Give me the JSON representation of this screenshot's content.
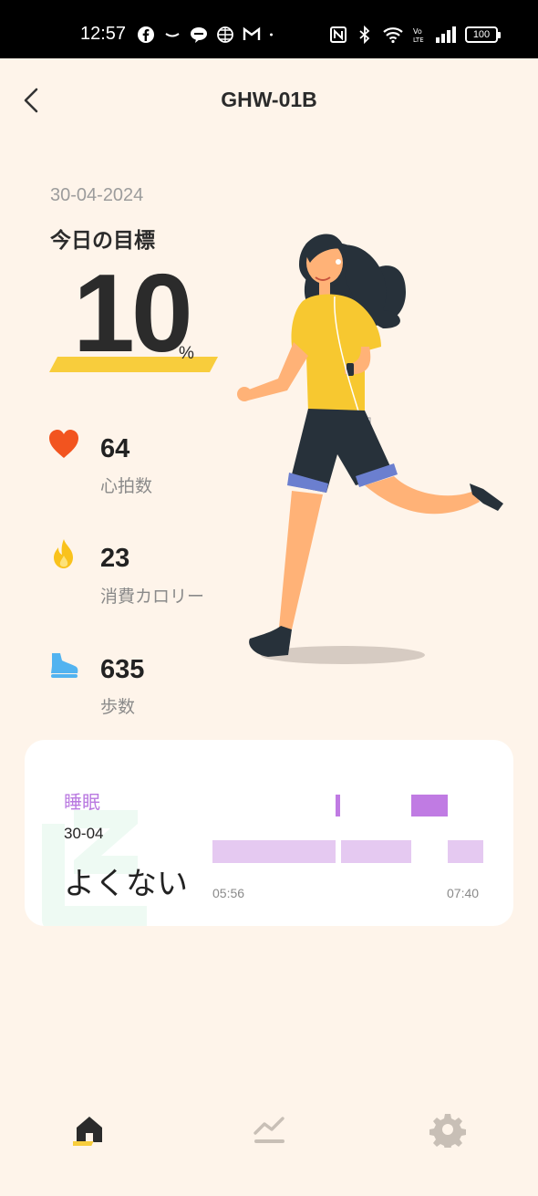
{
  "status_bar": {
    "time": "12:57",
    "left_icons": [
      "facebook-icon",
      "tilde-icon",
      "line-icon",
      "globe-icon",
      "gmail-icon",
      "dot-icon"
    ],
    "right_icons": [
      "nfc-icon",
      "bluetooth-icon",
      "wifi-icon",
      "volte-icon",
      "signal-icon"
    ],
    "battery": "100"
  },
  "header": {
    "title": "GHW-01B",
    "back_icon": "chevron-left-icon"
  },
  "goal": {
    "date": "30-04-2024",
    "label": "今日の目標",
    "value": "10",
    "unit": "%",
    "progress_percent": 10
  },
  "stats": [
    {
      "icon": "heart-icon",
      "value": "64",
      "label": "心拍数",
      "color": "#f2541f"
    },
    {
      "icon": "flame-icon",
      "value": "23",
      "label": "消費カロリー",
      "color": "#f9c21c"
    },
    {
      "icon": "shoe-icon",
      "value": "635",
      "label": "歩数",
      "color": "#52b3f0"
    }
  ],
  "sleep": {
    "title": "睡眠",
    "date": "30-04",
    "quality": "よくない",
    "start_time": "05:56",
    "end_time": "07:40",
    "colors": {
      "deep": "#c07be3",
      "light": "#e5c9f1",
      "title": "#b979e0"
    }
  },
  "bottom_nav": [
    {
      "icon": "home-icon",
      "active": true
    },
    {
      "icon": "trend-icon",
      "active": false
    },
    {
      "icon": "gear-icon",
      "active": false
    }
  ],
  "colors": {
    "background": "#fef4ea",
    "accent": "#f8cd3c",
    "text": "#2b2b2b"
  }
}
